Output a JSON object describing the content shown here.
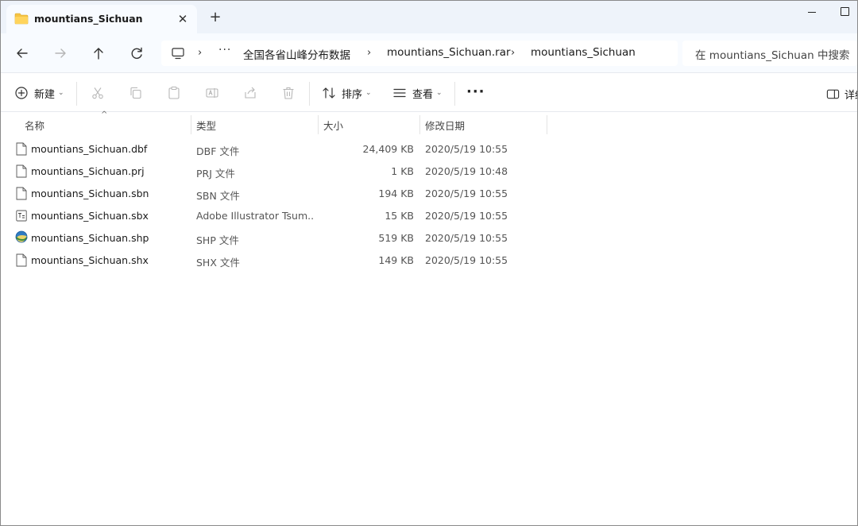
{
  "window": {
    "tab_title": "mountians_Sichuan",
    "tab_close_glyph": "✕",
    "new_tab_glyph": "+"
  },
  "nav": {
    "more_glyph": "···",
    "breadcrumbs": [
      "全国各省山峰分布数据",
      "mountians_Sichuan.rar",
      "mountians_Sichuan"
    ],
    "search_placeholder": "在 mountians_Sichuan 中搜索"
  },
  "toolbar": {
    "new_label": "新建",
    "sort_label": "排序",
    "view_label": "查看",
    "details_label": "详细"
  },
  "columns": {
    "name": "名称",
    "type": "类型",
    "size": "大小",
    "modified": "修改日期"
  },
  "files": [
    {
      "name": "mountians_Sichuan.dbf",
      "type": "DBF 文件",
      "size": "24,409 KB",
      "modified": "2020/5/19 10:55",
      "icon": "blank-file-icon"
    },
    {
      "name": "mountians_Sichuan.prj",
      "type": "PRJ 文件",
      "size": "1 KB",
      "modified": "2020/5/19 10:48",
      "icon": "blank-file-icon"
    },
    {
      "name": "mountians_Sichuan.sbn",
      "type": "SBN 文件",
      "size": "194 KB",
      "modified": "2020/5/19 10:55",
      "icon": "blank-file-icon"
    },
    {
      "name": "mountians_Sichuan.sbx",
      "type": "Adobe Illustrator Tsum...",
      "size": "15 KB",
      "modified": "2020/5/19 10:55",
      "icon": "text-file-icon"
    },
    {
      "name": "mountians_Sichuan.shp",
      "type": "SHP 文件",
      "size": "519 KB",
      "modified": "2020/5/19 10:55",
      "icon": "globe-file-icon"
    },
    {
      "name": "mountians_Sichuan.shx",
      "type": "SHX 文件",
      "size": "149 KB",
      "modified": "2020/5/19 10:55",
      "icon": "blank-file-icon"
    }
  ],
  "colors": {
    "titlebar_bg": "#eef3fa",
    "folder_yellow": "#f5c344",
    "accent_blue": "#2a6fd6"
  }
}
